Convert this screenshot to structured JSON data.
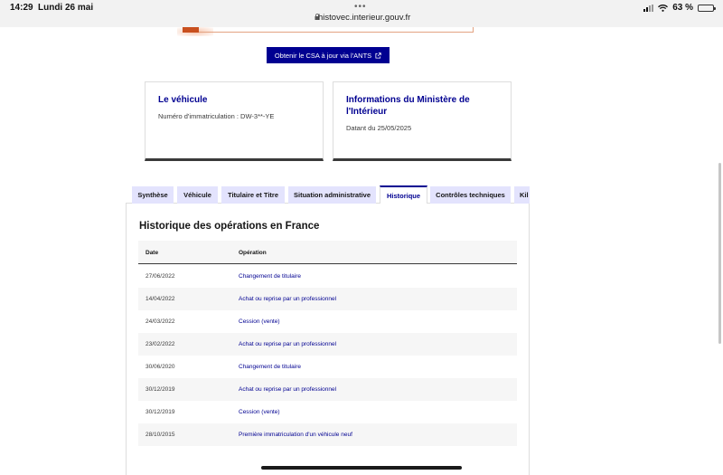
{
  "status_bar": {
    "time": "14:29",
    "date": "Lundi 26 mai",
    "url": "histovec.interieur.gouv.fr",
    "battery": "63 %",
    "battery_level": 0.63
  },
  "csa_button": {
    "label": "Obtenir le CSA à jour via l'ANTS"
  },
  "cards": {
    "vehicle": {
      "title": "Le véhicule",
      "text": "Numéro d'immatriculation : DW-3**-YE"
    },
    "ministry": {
      "title": "Informations du Ministère de l'Intérieur",
      "text": "Datant du 25/05/2025"
    }
  },
  "tabs": [
    {
      "label": "Synthèse"
    },
    {
      "label": "Véhicule"
    },
    {
      "label": "Titulaire et Titre"
    },
    {
      "label": "Situation administrative"
    },
    {
      "label": "Historique"
    },
    {
      "label": "Contrôles techniques"
    },
    {
      "label": "Kil"
    }
  ],
  "active_tab": "Historique",
  "history": {
    "title": "Historique des opérations en France",
    "columns": {
      "date": "Date",
      "operation": "Opération"
    },
    "rows": [
      {
        "date": "27/06/2022",
        "operation": "Changement de titulaire"
      },
      {
        "date": "14/04/2022",
        "operation": "Achat ou reprise par un professionnel"
      },
      {
        "date": "24/03/2022",
        "operation": "Cession (vente)"
      },
      {
        "date": "23/02/2022",
        "operation": "Achat ou reprise par un professionnel"
      },
      {
        "date": "30/06/2020",
        "operation": "Changement de titulaire"
      },
      {
        "date": "30/12/2019",
        "operation": "Achat ou reprise par un professionnel"
      },
      {
        "date": "30/12/2019",
        "operation": "Cession (vente)"
      },
      {
        "date": "28/10/2015",
        "operation": "Première immatriculation d'un véhicule neuf"
      }
    ]
  },
  "colors": {
    "accent": "#000091",
    "tab_bg": "#e3e3fd",
    "alert": "#c9501f"
  }
}
